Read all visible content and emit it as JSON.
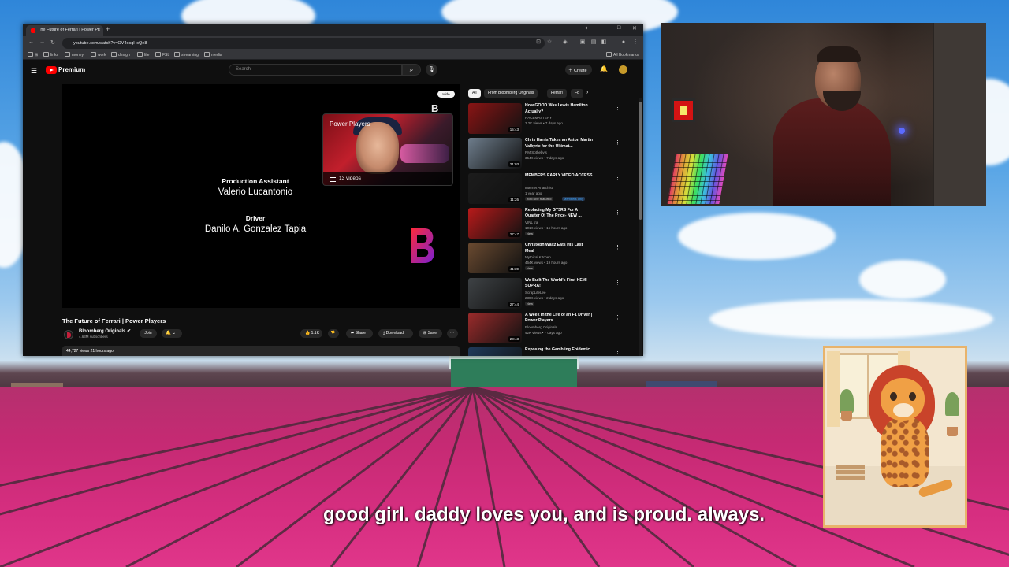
{
  "browser": {
    "tab_title": "The Future of Ferrari | Power Pl",
    "url": "youtube.com/watch?v=OV4osqHcQe8",
    "bookmarks": [
      "links",
      "money",
      "work",
      "design",
      "life",
      "FSL",
      "streaming",
      "media"
    ],
    "all_bookmarks": "All Bookmarks"
  },
  "youtube": {
    "brand": "Premium",
    "search_placeholder": "Search",
    "create_label": "Create",
    "player": {
      "hide_label": "Hide",
      "credits": [
        {
          "role": "Production Assistant",
          "name": "Valerio Lucantonio"
        },
        {
          "role": "Driver",
          "name": "Danilo A. Gonzalez Tapia"
        }
      ],
      "playlist_card": {
        "title": "Power Players",
        "count": "13 videos"
      }
    },
    "video": {
      "title": "The Future of Ferrari | Power Players",
      "channel": "Bloomberg Originals",
      "subscribers": "4.63M subscribers",
      "join_label": "Join",
      "likes": "1.1K",
      "share_label": "Share",
      "download_label": "Download",
      "save_label": "Save",
      "views": "44,727 views  21 hours ago"
    },
    "chips": [
      "All",
      "From Bloomberg Originals",
      "Ferrari",
      "Fo"
    ],
    "recommendations": [
      {
        "title": "How GOOD Was Lewis Hamilton Actually?",
        "channel": "RACEMASTERY",
        "meta": "3.2K views • 7 days ago",
        "duration": "15:43",
        "badge": "",
        "thumb": "#8a1414"
      },
      {
        "title": "Chris Harris Takes an Aston Martin Valkyrie for the Ultimat...",
        "channel": "RM Sotheby's",
        "meta": "354K views • 7 days ago",
        "duration": "21:03",
        "badge": "",
        "thumb": "#6e7d8c"
      },
      {
        "title": "MEMBERS EARLY VIDEO ACCESS",
        "channel": "Internet Anarchist",
        "meta": "1 year ago",
        "duration": "11:26",
        "badge": "YouTube featured",
        "badge2": "Members only",
        "thumb": "#1c1c1c"
      },
      {
        "title": "Replacing My GT3RS For A Quarter Of The Price- NEW ...",
        "channel": "VINL tra",
        "meta": "101K views • 16 hours ago",
        "duration": "27:47",
        "badge": "New",
        "thumb": "#b81a1a"
      },
      {
        "title": "Christoph Waltz Eats His Last Meal",
        "channel": "Mythical Kitchen",
        "meta": "464K views • 19 hours ago",
        "duration": "41:39",
        "badge": "New",
        "thumb": "#6a4a30"
      },
      {
        "title": "We Built The World's First HEMI SUPRA!",
        "channel": "ScrapLifeLee",
        "meta": "238K views • 2 days ago",
        "duration": "27:44",
        "badge": "New",
        "thumb": "#3e4245"
      },
      {
        "title": "A Week In the Life of an F1 Driver | Power Players",
        "channel": "Bloomberg Originals",
        "meta": "42K views • 7 days ago",
        "duration": "23:43",
        "badge": "",
        "thumb": "#9a2b2b"
      },
      {
        "title": "Exposing the Gambling Epidemic",
        "channel": "",
        "meta": "",
        "duration": "",
        "badge": "",
        "thumb": "#1f3a5a"
      }
    ]
  },
  "subtitle": "good girl. daddy loves you, and is proud. always."
}
